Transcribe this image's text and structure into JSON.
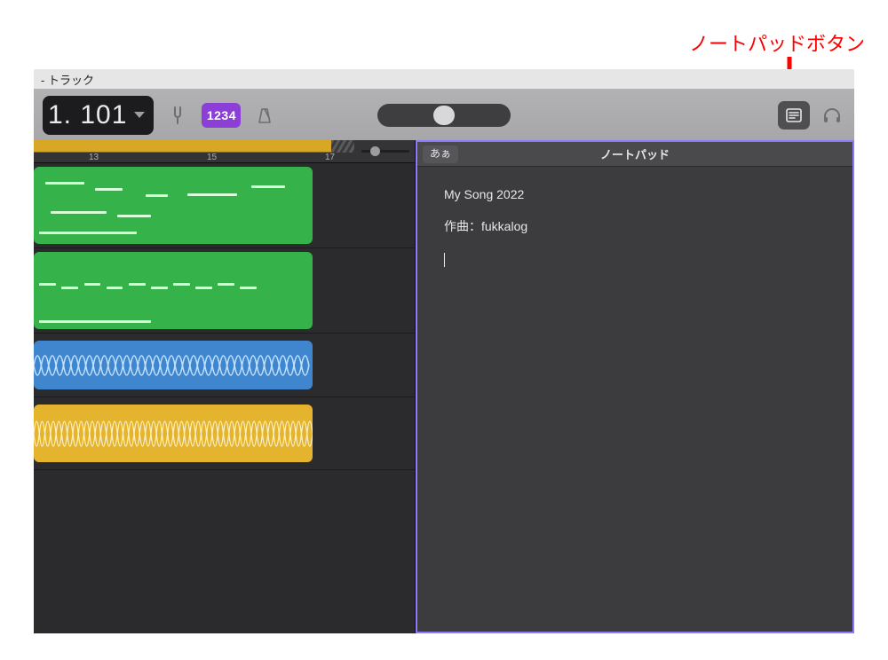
{
  "annotation": {
    "label": "ノートパッドボタン"
  },
  "window": {
    "title": "- トラック"
  },
  "transport": {
    "lcd_value": "1. 101",
    "count_in_label": "1234"
  },
  "ruler": {
    "ticks": [
      "13",
      "15",
      "17"
    ]
  },
  "notepad": {
    "ime_badge": "あぁ",
    "title": "ノートパッド",
    "lines": [
      "My Song 2022",
      "作曲：fukkalog",
      ""
    ]
  },
  "icons": {
    "tuning_fork": "tuning-fork-icon",
    "metronome": "metronome-icon",
    "notepad_btn": "notepad-icon",
    "headphones": "headphones-icon"
  }
}
